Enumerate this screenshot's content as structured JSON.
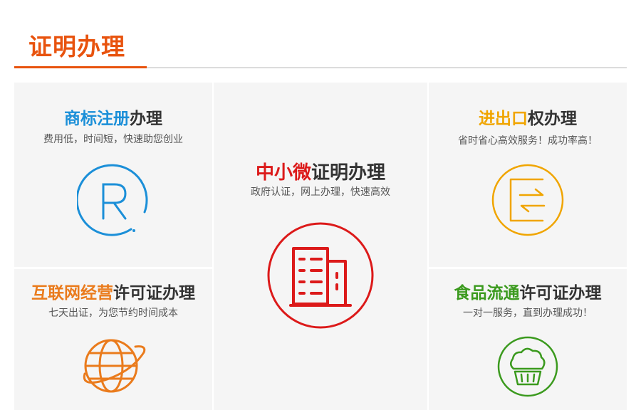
{
  "header": {
    "title": "证明办理"
  },
  "cards": {
    "trademark": {
      "title_highlight": "商标注册",
      "title_rest": "办理",
      "subtitle": "费用低，时间短，快速助您创业",
      "icon": "registered-trademark-icon",
      "accent": "#1b8fd8"
    },
    "sme": {
      "title_highlight": "中小微",
      "title_rest": "证明办理",
      "subtitle": "政府认证，网上办理，快速高效",
      "icon": "office-building-icon",
      "accent": "#dc1a1a"
    },
    "import_export": {
      "title_highlight": "进出口",
      "title_rest": "权办理",
      "subtitle": "省时省心高效服务！成功率高！",
      "icon": "exchange-arrows-icon",
      "accent": "#f0a500"
    },
    "internet": {
      "title_highlight": "互联网经营",
      "title_rest": "许可证办理",
      "subtitle": "七天出证，为您节约时间成本",
      "icon": "globe-icon",
      "accent": "#ea7b1c"
    },
    "food": {
      "title_highlight": "食品流通",
      "title_rest": "许可证办理",
      "subtitle": "一对一服务，直到办理成功！",
      "icon": "muffin-icon",
      "accent": "#3b9a1e"
    }
  }
}
